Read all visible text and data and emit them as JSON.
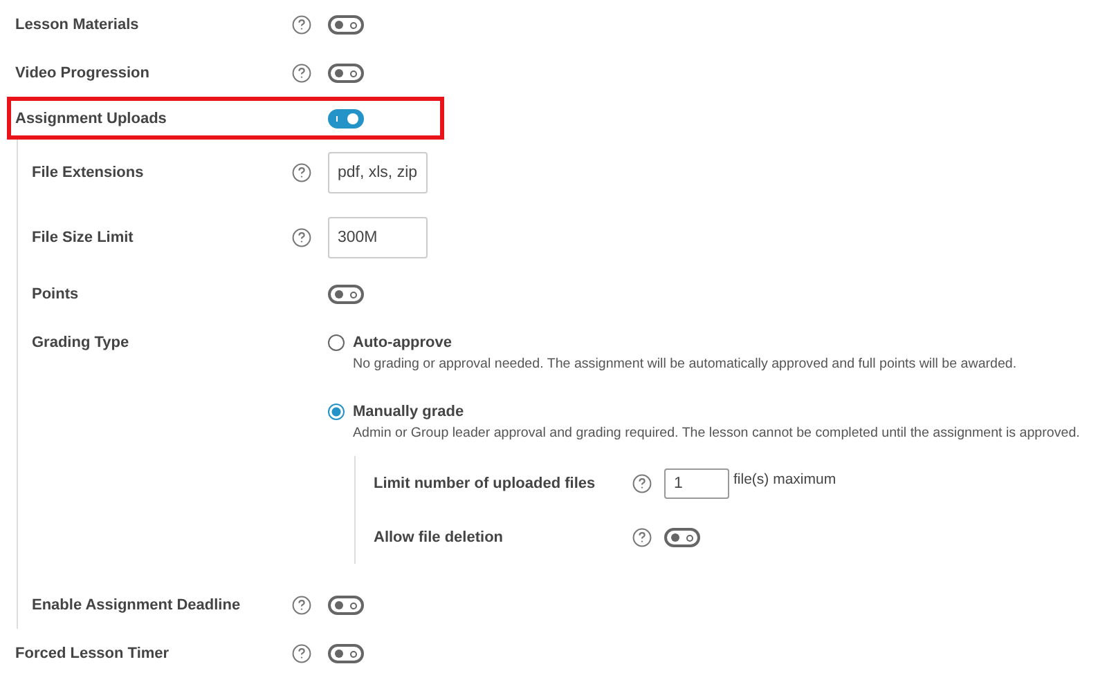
{
  "settings": [
    {
      "kind": "toggle",
      "label": "Lesson Materials",
      "help": true,
      "on": false
    },
    {
      "kind": "toggle",
      "label": "Video Progression",
      "help": true,
      "on": false
    },
    {
      "kind": "toggle",
      "label": "Assignment Uploads",
      "help": false,
      "on": true,
      "highlighted": true,
      "children": [
        {
          "kind": "text",
          "label": "File Extensions",
          "help": true,
          "value": "pdf, xls, zip"
        },
        {
          "kind": "text",
          "label": "File Size Limit",
          "help": true,
          "value": "300M"
        },
        {
          "kind": "toggle",
          "label": "Points",
          "help": false,
          "on": false
        },
        {
          "kind": "radio",
          "label": "Grading Type",
          "options": [
            {
              "label": "Auto-approve",
              "description": "No grading or approval needed. The assignment will be automatically approved and full points will be awarded.",
              "selected": false
            },
            {
              "label": "Manually grade",
              "description": "Admin or Group leader approval and grading required. The lesson cannot be completed until the assignment is approved.",
              "selected": true,
              "children": [
                {
                  "kind": "number",
                  "label": "Limit number of uploaded files",
                  "help": true,
                  "value": "1",
                  "suffix": "file(s) maximum"
                },
                {
                  "kind": "toggle",
                  "label": "Allow file deletion",
                  "help": true,
                  "on": false
                }
              ]
            }
          ]
        },
        {
          "kind": "toggle",
          "label": "Enable Assignment Deadline",
          "help": true,
          "on": false
        }
      ]
    },
    {
      "kind": "toggle",
      "label": "Forced Lesson Timer",
      "help": true,
      "on": false
    }
  ]
}
